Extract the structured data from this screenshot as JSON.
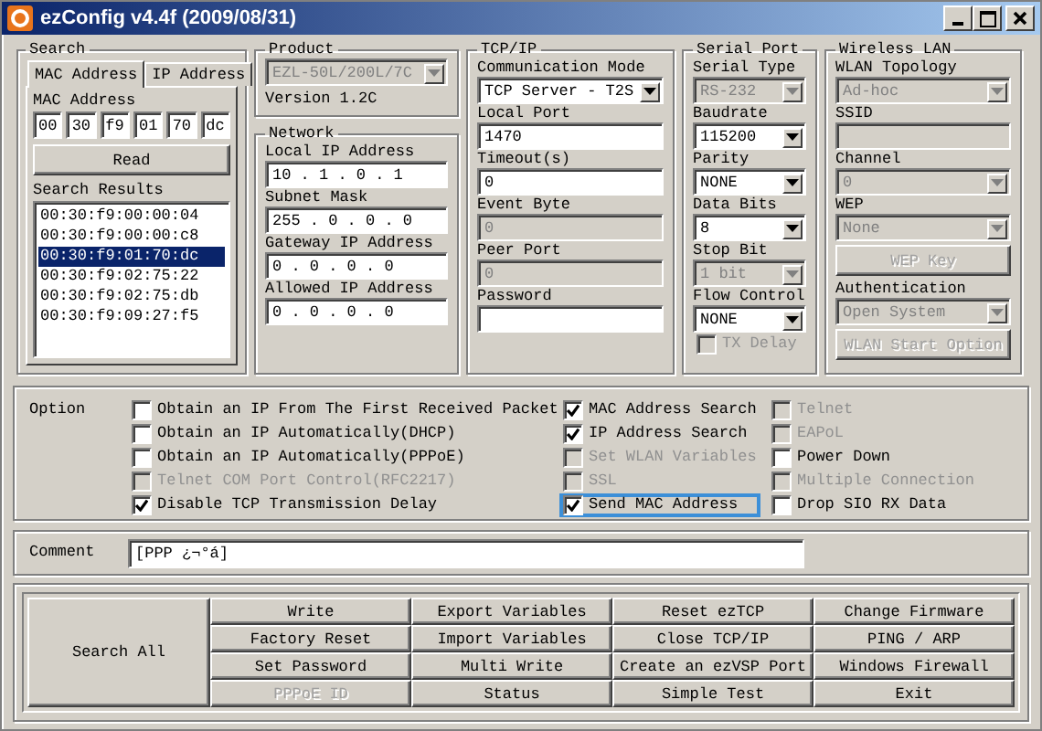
{
  "window": {
    "title": "ezConfig v4.4f (2009/08/31)"
  },
  "search": {
    "title": "Search",
    "tabs": [
      {
        "label": "MAC Address",
        "selected": true
      },
      {
        "label": "IP Address",
        "selected": false
      }
    ],
    "mac_label": "MAC Address",
    "mac_fields": [
      "00",
      "30",
      "f9",
      "01",
      "70",
      "dc"
    ],
    "read_button": "Read",
    "results_label": "Search Results",
    "results": [
      {
        "text": "00:30:f9:00:00:04",
        "selected": false
      },
      {
        "text": "00:30:f9:00:00:c8",
        "selected": false
      },
      {
        "text": "00:30:f9:01:70:dc",
        "selected": true
      },
      {
        "text": "00:30:f9:02:75:22",
        "selected": false
      },
      {
        "text": "00:30:f9:02:75:db",
        "selected": false
      },
      {
        "text": "00:30:f9:09:27:f5",
        "selected": false
      }
    ]
  },
  "product": {
    "title": "Product",
    "model": {
      "kind": "select",
      "value": "EZL-50L/200L/7C",
      "disabled": true
    },
    "version": "Version 1.2C"
  },
  "network": {
    "title": "Network",
    "fields": [
      {
        "label": "Local IP Address",
        "kind": "input",
        "value": "10 . 1 . 0 . 1",
        "disabled": false
      },
      {
        "label": "Subnet Mask",
        "kind": "input",
        "value": "255 . 0 . 0 . 0",
        "disabled": false
      },
      {
        "label": "Gateway IP Address",
        "kind": "input",
        "value": "0 . 0 . 0 . 0",
        "disabled": false
      },
      {
        "label": "Allowed IP Address",
        "kind": "input",
        "value": "0 . 0 . 0 . 0",
        "disabled": false
      }
    ]
  },
  "tcp_ip": {
    "title": "TCP/IP",
    "fields": [
      {
        "label": "Communication Mode",
        "kind": "select",
        "value": "TCP Server - T2S",
        "disabled": false
      },
      {
        "label": "Local Port",
        "kind": "input",
        "value": "1470",
        "disabled": false
      },
      {
        "label": "Timeout(s)",
        "kind": "input",
        "value": "0",
        "disabled": false
      },
      {
        "label": "Event Byte",
        "kind": "input",
        "value": "0",
        "disabled": true
      },
      {
        "label": "Peer Port",
        "kind": "input",
        "value": "0",
        "disabled": true
      },
      {
        "label": "Password",
        "kind": "input",
        "disabled": false
      }
    ]
  },
  "serial_port": {
    "title": "Serial Port",
    "fields": [
      {
        "label": "Serial Type",
        "kind": "select",
        "value": "RS-232",
        "disabled": true
      },
      {
        "label": "Baudrate",
        "kind": "select",
        "value": "115200",
        "disabled": false
      },
      {
        "label": "Parity",
        "kind": "select",
        "value": "NONE",
        "disabled": false
      },
      {
        "label": "Data Bits",
        "kind": "select",
        "value": "8",
        "disabled": false
      },
      {
        "label": "Stop Bit",
        "kind": "select",
        "value": "1 bit",
        "disabled": true
      },
      {
        "label": "Flow Control",
        "kind": "select",
        "value": "NONE",
        "disabled": false
      },
      {
        "label": "TX Delay",
        "kind": "checkbox",
        "checked": false,
        "disabled": true
      }
    ]
  },
  "wireless_lan": {
    "title": "Wireless LAN",
    "fields": [
      {
        "label": "WLAN Topology",
        "kind": "select",
        "value": "Ad-hoc",
        "disabled": true
      },
      {
        "label": "SSID",
        "kind": "input",
        "disabled": true
      },
      {
        "label": "Channel",
        "kind": "select",
        "value": "0",
        "disabled": true
      },
      {
        "label": "WEP",
        "kind": "select",
        "value": "None",
        "disabled": true
      },
      {
        "label": "WEP Key",
        "kind": "button",
        "disabled": true
      },
      {
        "label": "Authentication",
        "kind": "select",
        "value": "Open System",
        "disabled": true
      },
      {
        "label": "WLAN Start Option",
        "kind": "button",
        "disabled": true
      }
    ]
  },
  "option": {
    "title": "Option",
    "columns": [
      {
        "items": [
          {
            "label": "Obtain an IP From The First Received Packet",
            "checked": false,
            "disabled": false,
            "focused": false
          },
          {
            "label": "Obtain an IP Automatically(DHCP)",
            "checked": false,
            "disabled": false,
            "focused": false
          },
          {
            "label": "Obtain an IP Automatically(PPPoE)",
            "checked": false,
            "disabled": false,
            "focused": false
          },
          {
            "label": "Telnet COM Port Control(RFC2217)",
            "checked": false,
            "disabled": true,
            "focused": false
          },
          {
            "label": "Disable TCP Transmission Delay",
            "checked": true,
            "disabled": false,
            "focused": false
          }
        ]
      },
      {
        "items": [
          {
            "label": "MAC Address Search",
            "checked": true,
            "disabled": false,
            "focused": false
          },
          {
            "label": "IP Address Search",
            "checked": true,
            "disabled": false,
            "focused": false
          },
          {
            "label": "Set WLAN Variables",
            "checked": false,
            "disabled": true,
            "focused": false
          },
          {
            "label": "SSL",
            "checked": false,
            "disabled": true,
            "focused": false
          },
          {
            "label": "Send MAC Address",
            "checked": true,
            "disabled": false,
            "focused": true
          }
        ]
      },
      {
        "items": [
          {
            "label": "Telnet",
            "checked": false,
            "disabled": true,
            "focused": false
          },
          {
            "label": "EAPoL",
            "checked": false,
            "disabled": true,
            "focused": false
          },
          {
            "label": "Power Down",
            "checked": false,
            "disabled": false,
            "focused": false
          },
          {
            "label": "Multiple Connection",
            "checked": false,
            "disabled": true,
            "focused": false
          },
          {
            "label": "Drop SIO RX Data",
            "checked": false,
            "disabled": false,
            "focused": false
          }
        ]
      }
    ]
  },
  "comment": {
    "label": "Comment",
    "value": "[PPP ¿¬°á]"
  },
  "buttons": {
    "search_all": "Search All",
    "grid": [
      {
        "label": "Write",
        "disabled": false
      },
      {
        "label": "Export Variables",
        "disabled": false
      },
      {
        "label": "Reset ezTCP",
        "disabled": false
      },
      {
        "label": "Change Firmware",
        "disabled": false
      },
      {
        "label": "Factory Reset",
        "disabled": false
      },
      {
        "label": "Import Variables",
        "disabled": false
      },
      {
        "label": "Close TCP/IP",
        "disabled": false
      },
      {
        "label": "PING / ARP",
        "disabled": false
      },
      {
        "label": "Set Password",
        "disabled": false
      },
      {
        "label": "Multi Write",
        "disabled": false
      },
      {
        "label": "Create an ezVSP Port",
        "disabled": false
      },
      {
        "label": "Windows Firewall",
        "disabled": false
      },
      {
        "label": "PPPoE ID",
        "disabled": true
      },
      {
        "label": "Status",
        "disabled": false
      },
      {
        "label": "Simple Test",
        "disabled": false
      },
      {
        "label": "Exit",
        "disabled": false
      }
    ]
  }
}
